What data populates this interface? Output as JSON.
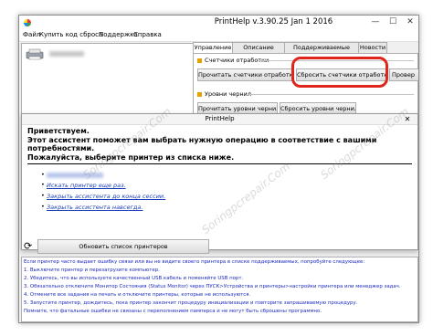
{
  "window": {
    "title": "PrintHelp v.3.90.25 Jan  1 2016",
    "minimize": "—",
    "maximize": "☐",
    "close": "✕"
  },
  "menu": [
    "Файл",
    "Купить код сброса",
    "Поддержка",
    "Справка"
  ],
  "tabs": [
    "Управление",
    "Описание ошибок",
    "Поддерживаемые модели",
    "Новости"
  ],
  "panel": {
    "counters_group": "Счетчики отработки",
    "read_counters": "Прочитать счетчики отработки",
    "reset_counters": "Сбросить счетчики отработки",
    "check": "Провер",
    "ink_group": "Уровни чернил",
    "read_ink": "Прочитать уровни чернил",
    "reset_ink": "Сбросить уровни чернил"
  },
  "dialog": {
    "title": "PrintHelp",
    "close": "✕",
    "line1": "Приветствуем.",
    "line2": "Этот ассистент поможет вам выбрать нужную операцию в соответствие с вашими потребностями.",
    "line3": "Пожалуйста, выберите принтер из списка ниже.",
    "links": [
      "Искать принтер еще раз.",
      "Закрыть ассистента до конца сессии.",
      "Закрыть ассистента навсегда."
    ]
  },
  "refresh_button": "Обновить список принтеров",
  "log": [
    "Если принтер часто выдает ошибку связи или вы не видите своего принтера в списке поддерживаемых, попробуйте следующее:",
    "1. Выключите принтер и перезагрузите компьютер.",
    "2. Убедитесь, что вы используете качественный USB кабель и поменяйте USB порт.",
    "3. Обязательно отключите Монитор Состояния (Status Monitor) через ПУСК>Устройства и принтеры>настройки принтера или менеджер задач.",
    "4. Отмените все задания на печать и отключите принтеры, которые не используются.",
    "5. Запустите принтер, дождитесь, пока принтер закончит процедуру инициализации и повторите запрашиваемую процедуру.",
    "Помните, что фатальные ошибки не связаны с переполнением памперса и не могут быть сброшены программно."
  ],
  "watermark": "Soringpcrepair.Com"
}
